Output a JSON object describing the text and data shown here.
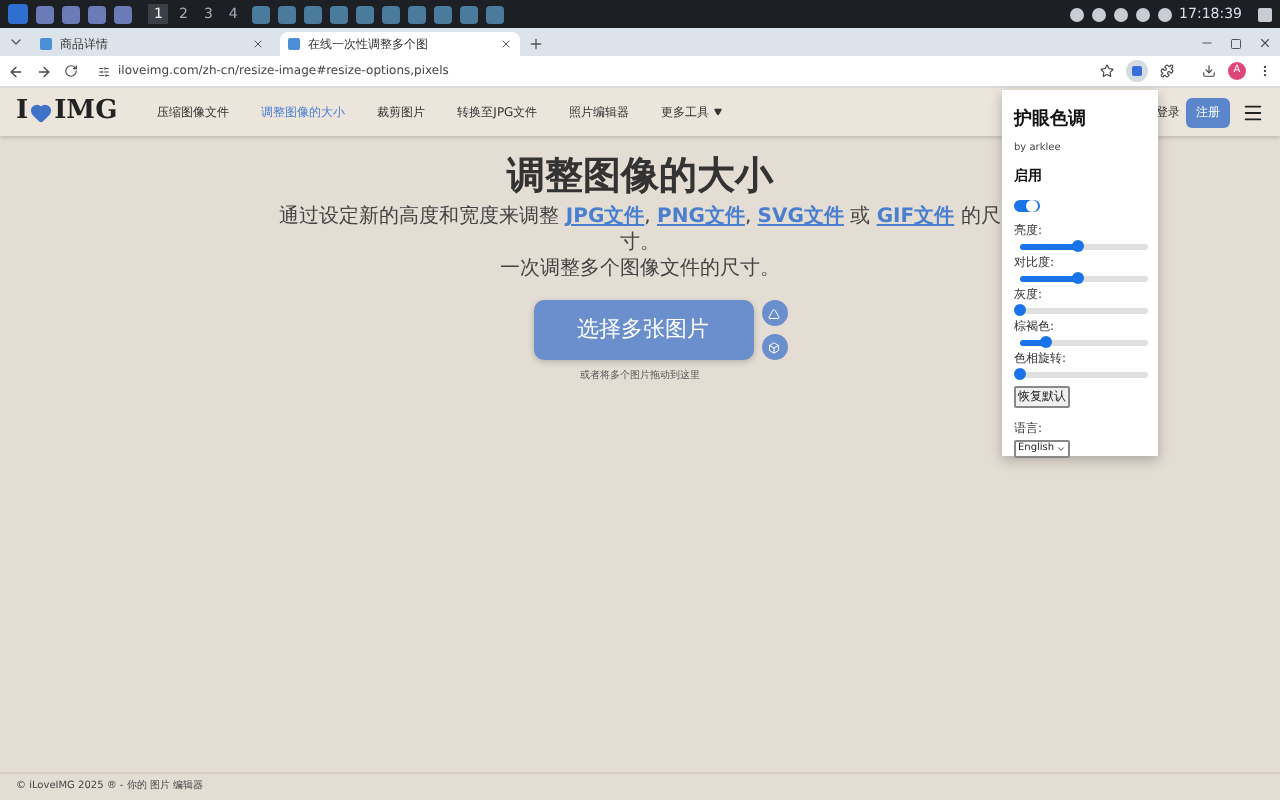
{
  "taskbar": {
    "workspaces": [
      {
        "label": "1",
        "selected": true
      },
      {
        "label": "2",
        "selected": false
      },
      {
        "label": "3",
        "selected": false
      },
      {
        "label": "4",
        "selected": false
      }
    ],
    "clock": "17:18:39"
  },
  "browser": {
    "tabs": [
      {
        "title": "商品详情",
        "selected": false
      },
      {
        "title": "在线一次性调整多个图",
        "selected": true
      }
    ],
    "url": "iloveimg.com/zh-cn/resize-image#resize-options,pixels",
    "profile": "A"
  },
  "site": {
    "logo_left": "I",
    "logo_right": "IMG",
    "nav": [
      {
        "label": "压缩图像文件",
        "selected": false
      },
      {
        "label": "调整图像的大小",
        "selected": true
      },
      {
        "label": "裁剪图片",
        "selected": false
      },
      {
        "label": "转换至JPG文件",
        "selected": false
      },
      {
        "label": "照片编辑器",
        "selected": false
      },
      {
        "label": "更多工具",
        "selected": false,
        "dropdown": true
      }
    ],
    "login": "登录",
    "signup": "注册"
  },
  "main": {
    "title": "调整图像的大小",
    "intro": [
      {
        "kind": "text",
        "text": "通过设定新的高度和宽度来调整 "
      },
      {
        "kind": "link",
        "text": "JPG文件"
      },
      {
        "kind": "text",
        "text": ", "
      },
      {
        "kind": "link",
        "text": "PNG文件"
      },
      {
        "kind": "text",
        "text": ", "
      },
      {
        "kind": "link",
        "text": "SVG文件"
      },
      {
        "kind": "text",
        "text": " 或 "
      },
      {
        "kind": "link",
        "text": "GIF文件"
      },
      {
        "kind": "text",
        "text": " 的尺寸。"
      }
    ],
    "subtitle": "一次调整多个图像文件的尺寸。",
    "select_button": "选择多张图片",
    "drop_hint": "或者将多个图片拖动到这里"
  },
  "footer": "© iLoveIMG 2025 ® - 你的 图片 编辑器",
  "extension": {
    "title": "护眼色调",
    "author": "by arklee",
    "enable_label": "启用",
    "enabled": true,
    "sliders": [
      {
        "label": "亮度:",
        "level": 0.45
      },
      {
        "label": "对比度:",
        "level": 0.45
      },
      {
        "label": "灰度:",
        "level": 0
      },
      {
        "label": "棕褐色:",
        "level": 0.2
      },
      {
        "label": "色相旋转:",
        "level": 0
      }
    ],
    "reset": "恢复默认",
    "language_label": "语言:",
    "language": "English"
  }
}
